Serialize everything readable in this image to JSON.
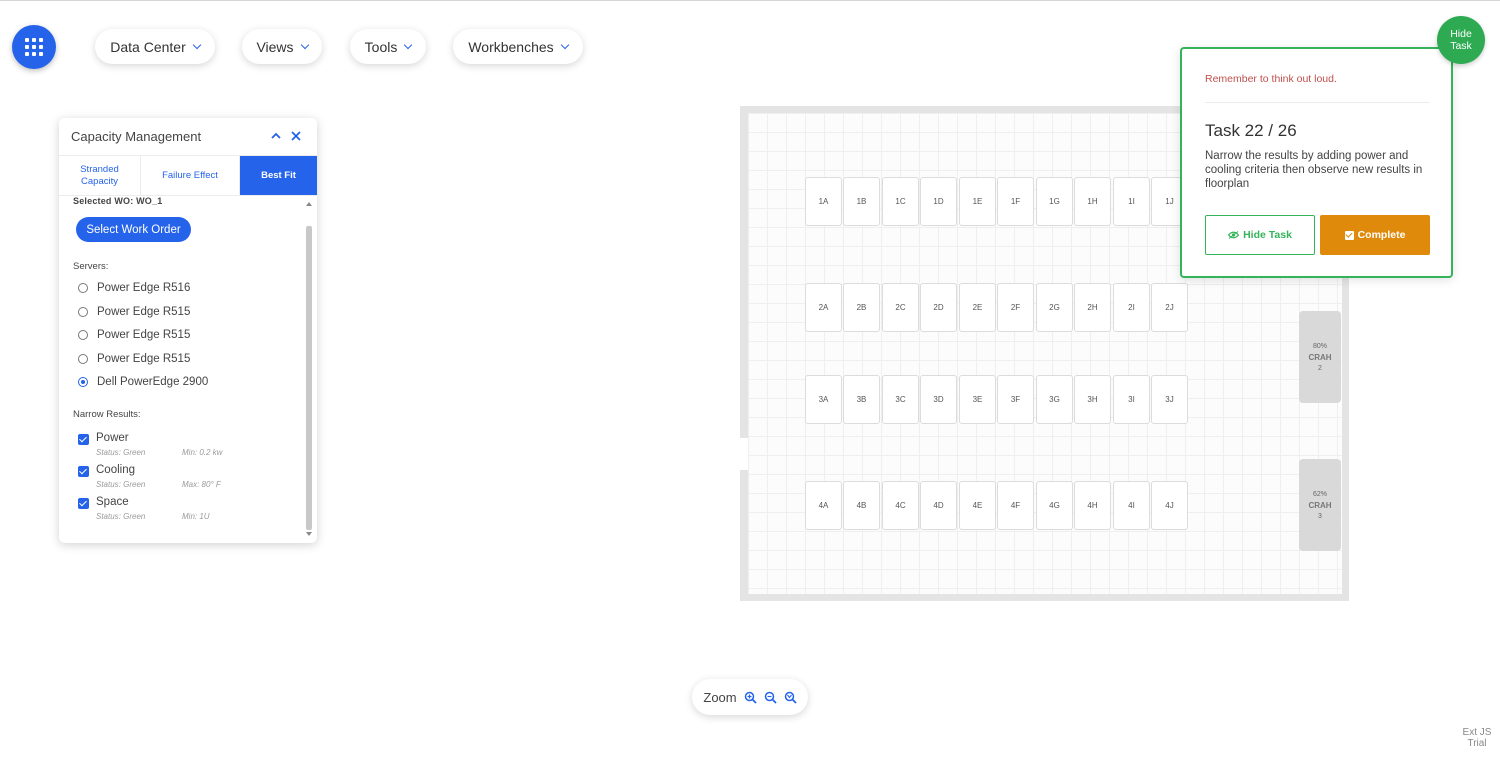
{
  "nav": {
    "menus": [
      {
        "label": "Data Center"
      },
      {
        "label": "Views"
      },
      {
        "label": "Tools"
      },
      {
        "label": "Workbenches"
      }
    ]
  },
  "panel": {
    "title": "Capacity Management",
    "tabs": [
      {
        "label": "Stranded Capacity",
        "active": false
      },
      {
        "label": "Failure Effect",
        "active": false
      },
      {
        "label": "Best Fit",
        "active": true
      }
    ],
    "selected_wo": "Selected WO: WO_1",
    "select_wo_button": "Select Work Order",
    "servers_label": "Servers:",
    "servers": [
      {
        "label": "Power Edge R516",
        "selected": false
      },
      {
        "label": "Power Edge R515",
        "selected": false
      },
      {
        "label": "Power Edge R515",
        "selected": false
      },
      {
        "label": "Power Edge R515",
        "selected": false
      },
      {
        "label": "Dell PowerEdge 2900",
        "selected": true
      }
    ],
    "narrow_label": "Narrow Results:",
    "narrow": [
      {
        "label": "Power",
        "status": "Status: Green",
        "limit": "Min: 0.2 kw",
        "checked": true
      },
      {
        "label": "Cooling",
        "status": "Status: Green",
        "limit": "Max: 80° F",
        "checked": true
      },
      {
        "label": "Space",
        "status": "Status: Green",
        "limit": "Min: 1U",
        "checked": true
      }
    ]
  },
  "floorplan": {
    "rows": [
      [
        "1A",
        "1B",
        "1C",
        "1D",
        "1E",
        "1F",
        "1G",
        "1H",
        "1I",
        "1J"
      ],
      [
        "2A",
        "2B",
        "2C",
        "2D",
        "2E",
        "2F",
        "2G",
        "2H",
        "2I",
        "2J"
      ],
      [
        "3A",
        "3B",
        "3C",
        "3D",
        "3E",
        "3F",
        "3G",
        "3H",
        "3I",
        "3J"
      ],
      [
        "4A",
        "4B",
        "4C",
        "4D",
        "4E",
        "4F",
        "4G",
        "4H",
        "4I",
        "4J"
      ]
    ],
    "crah": [
      {
        "percent": "80%",
        "name": "CRAH",
        "number": "2"
      },
      {
        "percent": "62%",
        "name": "CRAH",
        "number": "3"
      }
    ]
  },
  "task": {
    "reminder": "Remember to think out loud.",
    "title": "Task 22 / 26",
    "description": "Narrow the results by adding power and cooling criteria then observe new results in floorplan",
    "hide_button": "Hide Task",
    "complete_button": "Complete",
    "bubble_label": "Hide Task"
  },
  "zoom": {
    "label": "Zoom"
  },
  "watermark": {
    "line1": "Ext JS",
    "line2": "Trial"
  },
  "colors": {
    "primary": "#2563eb",
    "success": "#34b35a",
    "complete": "#e08a0b",
    "reminder": "#c0504d"
  },
  "icons": [
    "apps-grid-icon",
    "chevron-down-icon",
    "chevron-up-icon",
    "close-icon",
    "eye-icon",
    "checkbox-icon",
    "zoom-in-icon",
    "zoom-out-icon",
    "zoom-reset-icon"
  ]
}
